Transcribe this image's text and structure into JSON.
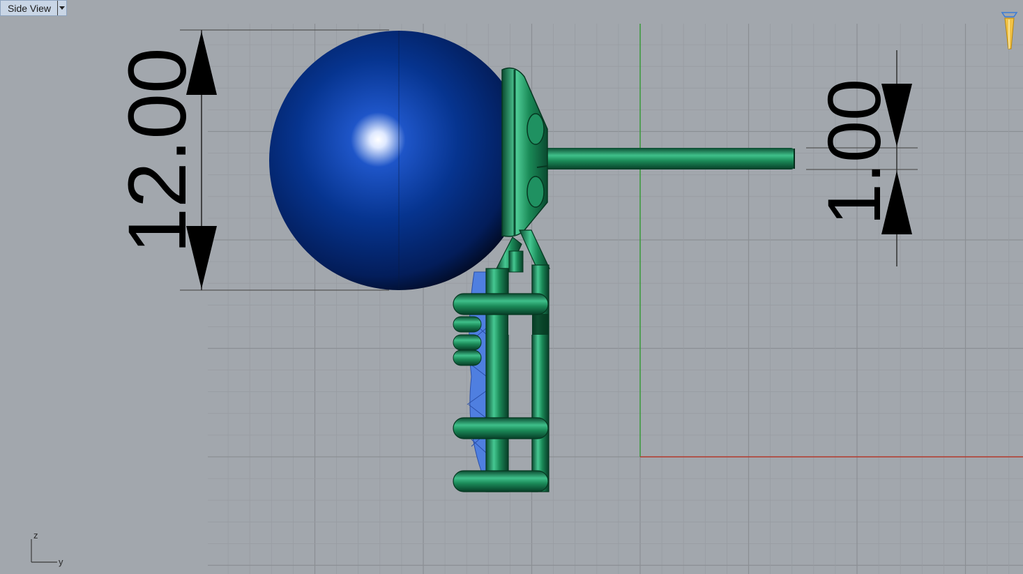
{
  "viewport": {
    "title": "Side View",
    "menu_icon": "chevron-down-icon"
  },
  "dimensions": {
    "large": "12.00",
    "small": "1.00"
  },
  "axis_triad": {
    "z_label": "z",
    "y_label": "y"
  },
  "colors": {
    "background": "#a2a7ad",
    "grid_minor": "#989ca2",
    "grid_major": "#8b8f94",
    "x_axis": "#b53a2f",
    "z_axis": "#3b9a3b",
    "pearl": "#062a7a",
    "metal": "#1e8a5a",
    "gems": "#4f7fe0"
  }
}
